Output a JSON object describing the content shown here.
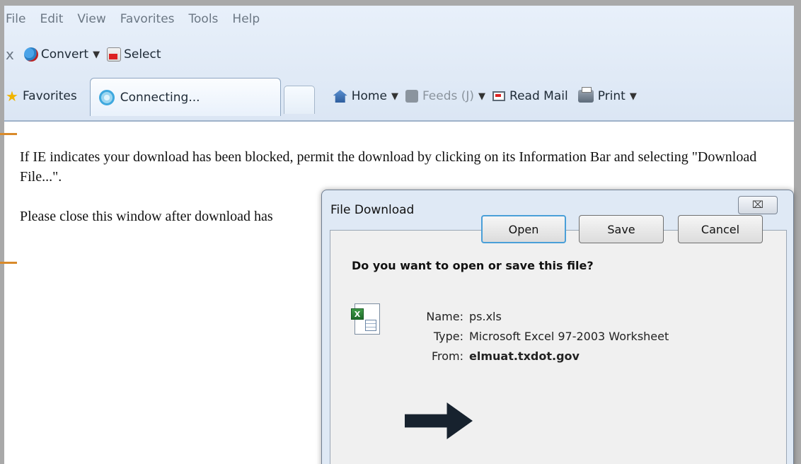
{
  "menubar": {
    "items": [
      "File",
      "Edit",
      "View",
      "Favorites",
      "Tools",
      "Help"
    ]
  },
  "commandbar": {
    "close": "x",
    "convert_label": "Convert",
    "select_label": "Select"
  },
  "favbar": {
    "favorites_label": "Favorites",
    "tab_title": "Connecting...",
    "home_label": "Home",
    "feeds_label": "Feeds (J)",
    "mail_label": "Read Mail",
    "print_label": "Print"
  },
  "page": {
    "line1": "If IE indicates your download has been blocked, permit the download by clicking on its Information Bar and selecting \"Download File...\".",
    "line2": "Please close this window after download has"
  },
  "dialog": {
    "title": "File Download",
    "close_glyph": "⌧",
    "question": "Do you want to open or save this file?",
    "name_label": "Name:",
    "name_value": "ps.xls",
    "type_label": "Type:",
    "type_value": "Microsoft Excel 97-2003 Worksheet",
    "from_label": "From:",
    "from_value": "elmuat.txdot.gov",
    "open_label": "Open",
    "save_label": "Save",
    "cancel_label": "Cancel"
  },
  "icons": [
    "convert-icon",
    "pdf-select-icon",
    "favorites-star-icon",
    "loading-spinner-icon",
    "home-icon",
    "feeds-icon",
    "mail-icon",
    "print-icon",
    "excel-file-icon",
    "pointer-arrow-icon"
  ],
  "colors": {
    "accent": "#4a9fd8",
    "chrome": "#dbe6f4",
    "frame": "#a9a9a9",
    "orange_marker": "#d98a2a"
  }
}
